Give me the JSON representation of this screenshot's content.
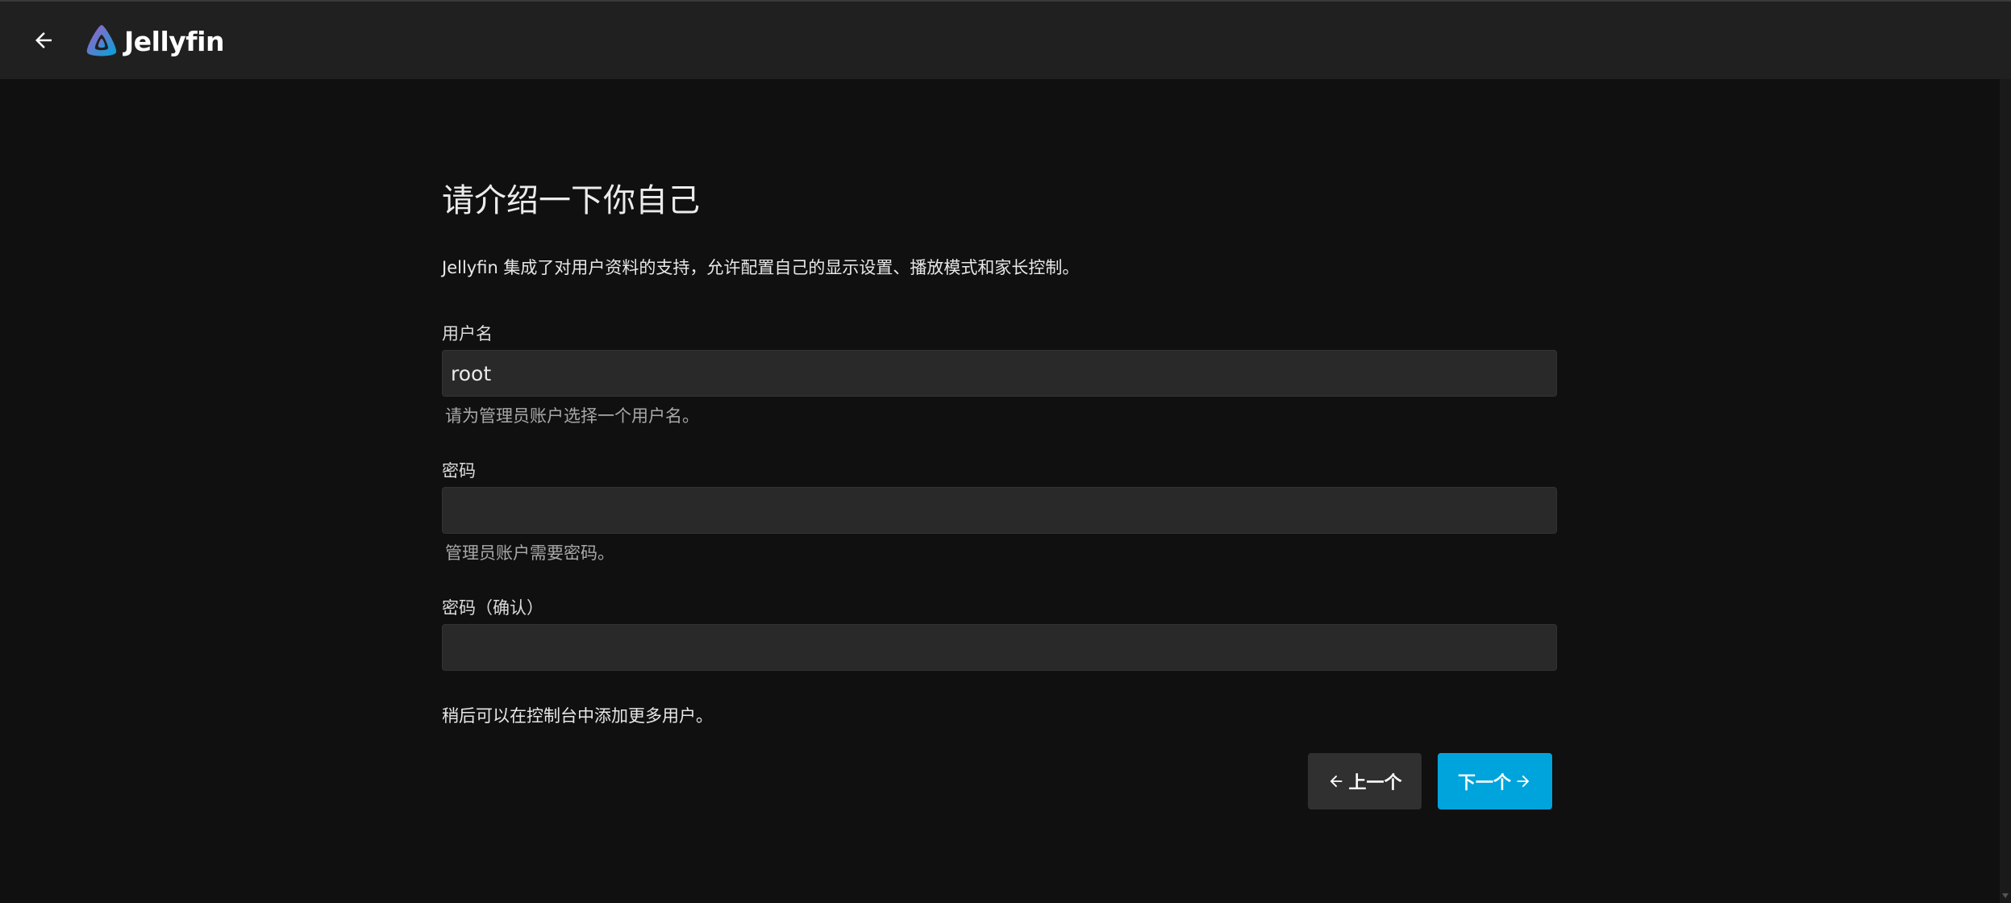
{
  "header": {
    "brand": "Jellyfin",
    "back_icon": "arrow-left-icon",
    "logo_icon": "jellyfin-logo-icon"
  },
  "page": {
    "title": "请介绍一下你自己",
    "intro": "Jellyfin 集成了对用户资料的支持，允许配置自己的显示设置、播放模式和家长控制。",
    "username": {
      "label": "用户名",
      "value": "root",
      "hint": "请为管理员账户选择一个用户名。"
    },
    "password": {
      "label": "密码",
      "value": "",
      "hint": "管理员账户需要密码。"
    },
    "password_confirm": {
      "label": "密码（确认）",
      "value": ""
    },
    "footer_note": "稍后可以在控制台中添加更多用户。",
    "prev_label": "上一个",
    "next_label": "下一个"
  },
  "colors": {
    "accent": "#00a4dc",
    "header_bg": "#202020",
    "page_bg": "#101010",
    "input_bg": "#292929"
  }
}
